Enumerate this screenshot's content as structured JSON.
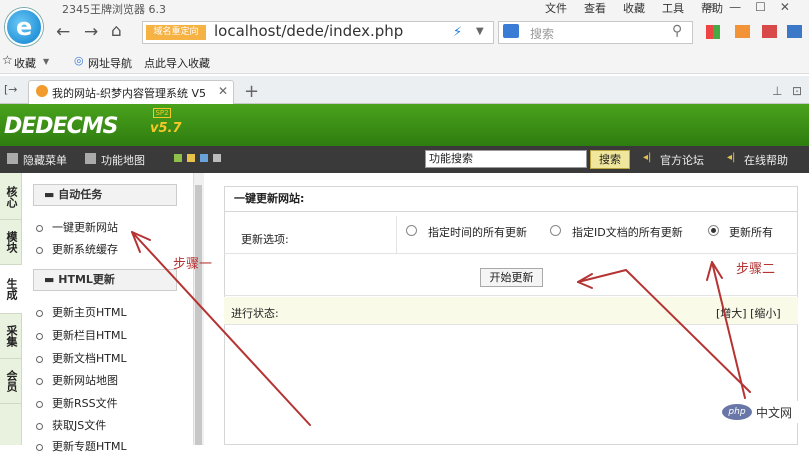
{
  "browser": {
    "title": "2345王牌浏览器 6.3",
    "menu": [
      "文件",
      "查看",
      "收藏",
      "工具",
      "帮助"
    ],
    "url_badge": "域名重定向",
    "url": "localhost/dede/index.php",
    "search_placeholder": "搜索",
    "bookmarks": [
      "收藏",
      "网址导航",
      "点此导入收藏"
    ],
    "tab_title": "我的网站-织梦内容管理系统 V5"
  },
  "dede": {
    "logo": "DEDECMS",
    "version": "v5.7",
    "badge": "SP2",
    "toolbar": {
      "hide_menu": "隐藏菜单",
      "func_map": "功能地图",
      "search_value": "功能搜索",
      "search_btn": "搜索",
      "forum": "官方论坛",
      "help": "在线帮助"
    },
    "vtabs": [
      "核心",
      "模块",
      "生成",
      "采集",
      "会员"
    ],
    "sections": [
      {
        "title": "自动任务",
        "items": [
          "一键更新网站",
          "更新系统缓存"
        ]
      },
      {
        "title": "HTML更新",
        "items": [
          "更新主页HTML",
          "更新栏目HTML",
          "更新文档HTML",
          "更新网站地图",
          "更新RSS文件",
          "获取JS文件",
          "更新专题HTML"
        ]
      }
    ],
    "main": {
      "title": "一键更新网站:",
      "option_label": "更新选项:",
      "options": [
        {
          "label": "指定时间的所有更新",
          "checked": false
        },
        {
          "label": "指定ID文档的所有更新",
          "checked": false
        },
        {
          "label": "更新所有",
          "checked": true
        }
      ],
      "start_btn": "开始更新",
      "status_label": "进行状态:",
      "zoom": "[增大] [缩小]"
    }
  },
  "annotations": {
    "step1": "步骤一",
    "step2": "步骤二",
    "color": "#b53333"
  },
  "watermark": {
    "logo": "php",
    "text": "中文网"
  }
}
